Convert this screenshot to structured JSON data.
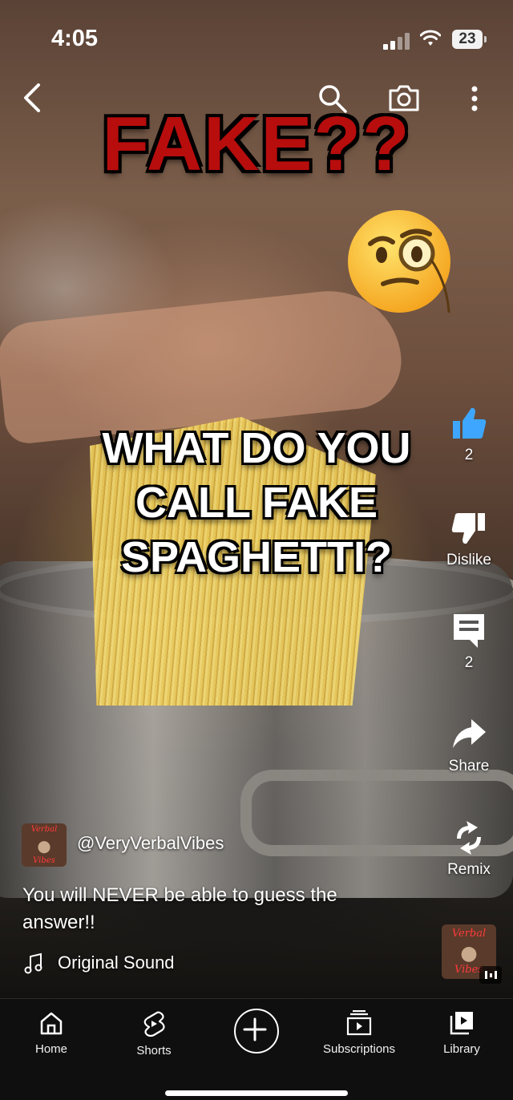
{
  "status_bar": {
    "time": "4:05",
    "battery": "23"
  },
  "video": {
    "overlay_title": "FAKE??",
    "overlay_question": "WHAT DO YOU CALL FAKE SPAGHETTI?"
  },
  "actions": {
    "like_count": "2",
    "dislike_label": "Dislike",
    "comment_count": "2",
    "share_label": "Share",
    "remix_label": "Remix"
  },
  "channel": {
    "handle": "@VeryVerbalVibes",
    "avatar_text_top": "Verbal",
    "avatar_text_bottom": "Vibes"
  },
  "caption": "You will NEVER be able to guess the answer!!",
  "sound": {
    "name": "Original Sound"
  },
  "bottom_nav": {
    "home": "Home",
    "shorts": "Shorts",
    "subscriptions": "Subscriptions",
    "library": "Library"
  },
  "colors": {
    "accent_like": "#3ea6ff",
    "title_red": "#b80d0d"
  }
}
